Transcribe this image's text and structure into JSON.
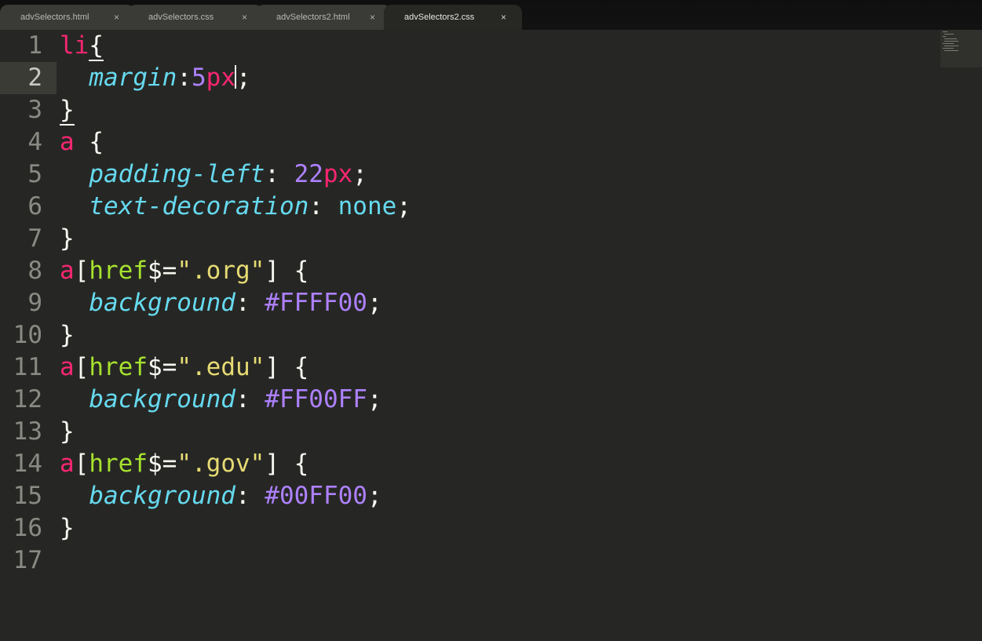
{
  "tabs": [
    {
      "label": "advSelectors.html",
      "close": "×"
    },
    {
      "label": "advSelectors.css",
      "close": "×"
    },
    {
      "label": "advSelectors2.html",
      "close": "×"
    },
    {
      "label": "advSelectors2.css",
      "close": "×"
    }
  ],
  "active_tab": "advSelectors2.css",
  "line_numbers": [
    "1",
    "2",
    "3",
    "4",
    "5",
    "6",
    "7",
    "8",
    "9",
    "10",
    "11",
    "12",
    "13",
    "14",
    "15",
    "16",
    "17"
  ],
  "current_line": 2,
  "code": {
    "l1_selector": "li",
    "l1_brace": "{",
    "l2_prop": "margin",
    "l2_colon": ":",
    "l2_num": "5",
    "l2_unit": "px",
    "l2_semi": ";",
    "l3": "}",
    "l4_selector": "a",
    "l4_brace": " {",
    "l5_prop": "padding-left",
    "l5_colon": ": ",
    "l5_num": "22",
    "l5_unit": "px",
    "l5_semi": ";",
    "l6_prop": "text-decoration",
    "l6_colon": ": ",
    "l6_val": "none",
    "l6_semi": ";",
    "l7": "}",
    "l8_selector": "a",
    "l8_open": "[",
    "l8_attr": "href",
    "l8_op": "$=",
    "l8_str": "\".org\"",
    "l8_close": "] {",
    "l9_prop": "background",
    "l9_colon": ": ",
    "l9_val": "#FFFF00",
    "l9_semi": ";",
    "l10": "}",
    "l11_selector": "a",
    "l11_open": "[",
    "l11_attr": "href",
    "l11_op": "$=",
    "l11_str": "\".edu\"",
    "l11_close": "] {",
    "l12_prop": "background",
    "l12_colon": ": ",
    "l12_val": "#FF00FF",
    "l12_semi": ";",
    "l13": "}",
    "l14_selector": "a",
    "l14_open": "[",
    "l14_attr": "href",
    "l14_op": "$=",
    "l14_str": "\".gov\"",
    "l14_close": "] {",
    "l15_prop": "background",
    "l15_colon": ": ",
    "l15_val": "#00FF00",
    "l15_semi": ";",
    "l16": "}"
  },
  "colors": {
    "background": "#262724",
    "tag": "#f92672",
    "property": "#66d9ef",
    "number": "#ae81ff",
    "attribute": "#a6e22e",
    "string": "#e6db74",
    "text": "#f8f8f2"
  }
}
